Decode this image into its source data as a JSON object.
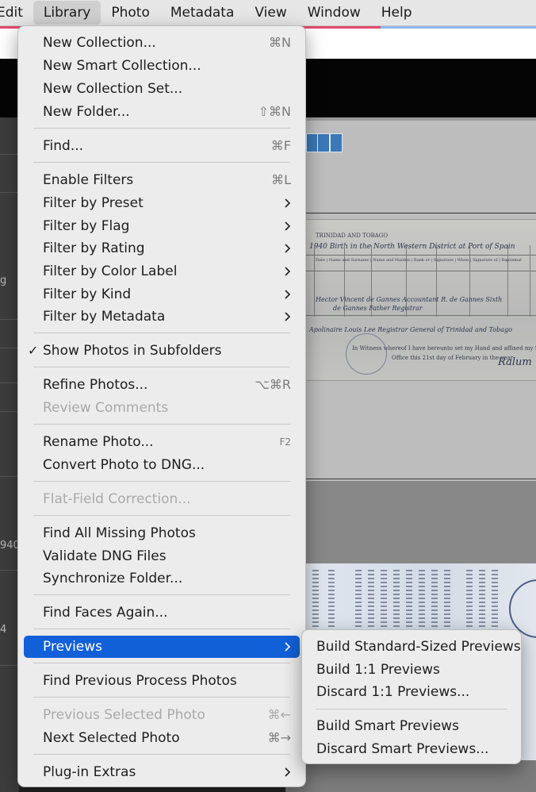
{
  "menubar": {
    "items": [
      "Edit",
      "Library",
      "Photo",
      "Metadata",
      "View",
      "Window",
      "Help"
    ],
    "active": "Library"
  },
  "left_panel": {
    "text_1": "g",
    "text_2": "940",
    "text_3": "4"
  },
  "library_menu": {
    "new_collection": {
      "label": "New Collection...",
      "shortcut": "⌘N"
    },
    "new_smart_collection": {
      "label": "New Smart Collection..."
    },
    "new_collection_set": {
      "label": "New Collection Set..."
    },
    "new_folder": {
      "label": "New Folder...",
      "shortcut": "⇧⌘N"
    },
    "find": {
      "label": "Find...",
      "shortcut": "⌘F"
    },
    "enable_filters": {
      "label": "Enable Filters",
      "shortcut": "⌘L"
    },
    "filter_by_preset": {
      "label": "Filter by Preset"
    },
    "filter_by_flag": {
      "label": "Filter by Flag"
    },
    "filter_by_rating": {
      "label": "Filter by Rating"
    },
    "filter_by_color_label": {
      "label": "Filter by Color Label"
    },
    "filter_by_kind": {
      "label": "Filter by Kind"
    },
    "filter_by_metadata": {
      "label": "Filter by Metadata"
    },
    "show_photos_in_subfolders": {
      "label": "Show Photos in Subfolders",
      "check": "✓"
    },
    "refine_photos": {
      "label": "Refine Photos...",
      "shortcut": "⌥⌘R"
    },
    "review_comments": {
      "label": "Review Comments"
    },
    "rename_photo": {
      "label": "Rename Photo...",
      "shortcut": "F2"
    },
    "convert_photo_to_dng": {
      "label": "Convert Photo to DNG..."
    },
    "flat_field_correction": {
      "label": "Flat-Field Correction..."
    },
    "find_all_missing_photos": {
      "label": "Find All Missing Photos"
    },
    "validate_dng_files": {
      "label": "Validate DNG Files"
    },
    "synchronize_folder": {
      "label": "Synchronize Folder..."
    },
    "find_faces_again": {
      "label": "Find Faces Again..."
    },
    "previews": {
      "label": "Previews"
    },
    "find_previous_process_photos": {
      "label": "Find Previous Process Photos"
    },
    "previous_selected_photo": {
      "label": "Previous Selected Photo",
      "shortcut": "⌘←"
    },
    "next_selected_photo": {
      "label": "Next Selected Photo",
      "shortcut": "⌘→"
    },
    "plugin_extras": {
      "label": "Plug-in Extras"
    }
  },
  "previews_submenu": {
    "build_standard": {
      "label": "Build Standard-Sized Previews"
    },
    "build_1_1": {
      "label": "Build 1:1 Previews"
    },
    "discard_1_1": {
      "label": "Discard 1:1 Previews..."
    },
    "build_smart": {
      "label": "Build Smart Previews"
    },
    "discard_smart": {
      "label": "Discard Smart Previews..."
    }
  },
  "colors": {
    "highlight": "#1260d8",
    "menu_background": "#ececec",
    "menubar_background": "#e6e6e6",
    "disabled_text": "#a9a9a9"
  },
  "icons": {
    "checkmark": "checkmark-icon",
    "submenu_arrow": "chevron-right-icon"
  }
}
